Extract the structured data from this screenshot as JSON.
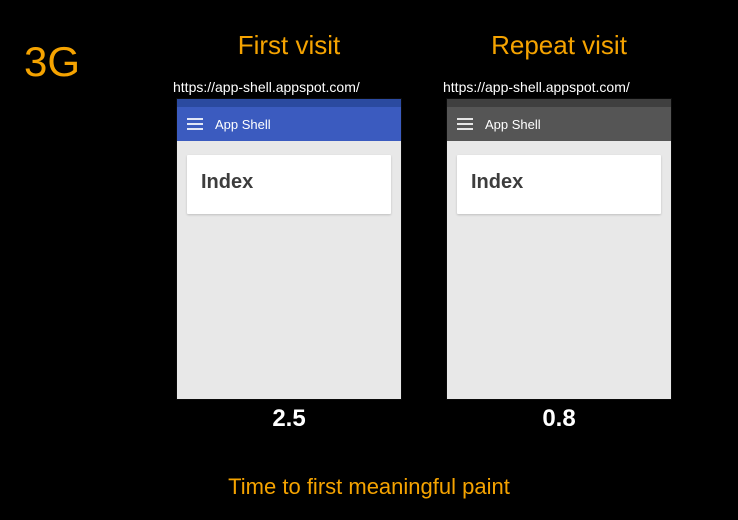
{
  "badge": "3G",
  "caption": "Time to first meaningful paint",
  "columns": {
    "first": {
      "title": "First visit",
      "url": "https://app-shell.appspot.com/",
      "appbar_title": "App Shell",
      "card_title": "Index",
      "timing": "2.5"
    },
    "repeat": {
      "title": "Repeat visit",
      "url": "https://app-shell.appspot.com/",
      "appbar_title": "App Shell",
      "card_title": "Index",
      "timing": "0.8"
    }
  }
}
